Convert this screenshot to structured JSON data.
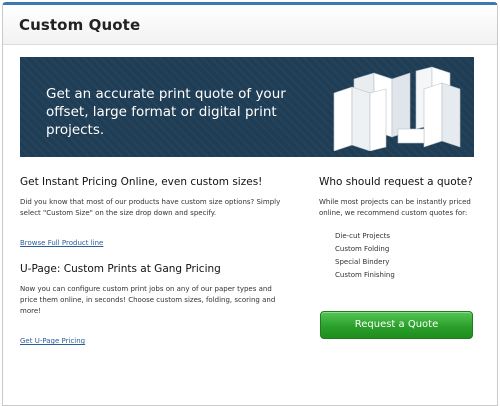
{
  "header": {
    "title": "Custom Quote"
  },
  "banner": {
    "text": "Get an accurate print quote of your offset, large format or digital print projects.",
    "image_icon": "brochure-stack-icon",
    "background_color": "#1f3e56"
  },
  "pricing": {
    "heading": "Get Instant Pricing Online, even custom sizes!",
    "body": "Did you know that most of our products have custom size options? Simply select \"Custom Size\" on the size drop down and specify.",
    "link_label": "Browse Full Product line"
  },
  "upage": {
    "heading": "U-Page: Custom Prints at Gang Pricing",
    "body": "Now you can configure custom print jobs on any of our paper types and price them online, in seconds! Choose custom sizes, folding, scoring and more!",
    "link_label": "Get U-Page Pricing"
  },
  "who": {
    "heading": "Who should request a quote?",
    "body": "While most projects can be instantly priced online, we recommend custom quotes for:",
    "items": [
      "Die-cut Projects",
      "Custom Folding",
      "Special Bindery",
      "Custom Finishing"
    ]
  },
  "cta": {
    "label": "Request a Quote",
    "color": "#2aa02a"
  },
  "colors": {
    "accent_top": "#3c78b4",
    "link": "#2a5d9c"
  }
}
